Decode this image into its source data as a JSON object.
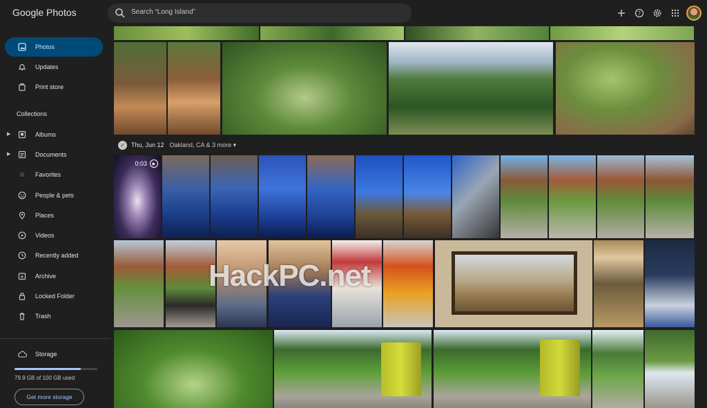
{
  "app": {
    "title": "Google Photos"
  },
  "search": {
    "placeholder": "Search “Long Island”",
    "value": ""
  },
  "top_icons": [
    "add-icon",
    "help-icon",
    "settings-icon",
    "apps-grid-icon",
    "account-avatar"
  ],
  "sidebar": {
    "items": [
      {
        "label": "Photos",
        "icon": "photos-icon",
        "active": true
      },
      {
        "label": "Updates",
        "icon": "bell-icon"
      },
      {
        "label": "Print store",
        "icon": "print-store-icon"
      }
    ],
    "collections_title": "Collections",
    "collections": [
      {
        "label": "Albums",
        "icon": "album-icon",
        "expandable": true
      },
      {
        "label": "Documents",
        "icon": "document-icon",
        "expandable": true
      },
      {
        "label": "Favorites",
        "icon": "star-icon"
      },
      {
        "label": "People & pets",
        "icon": "face-icon"
      },
      {
        "label": "Places",
        "icon": "place-pin-icon"
      },
      {
        "label": "Videos",
        "icon": "video-play-icon"
      },
      {
        "label": "Recently added",
        "icon": "clock-icon"
      },
      {
        "label": "Archive",
        "icon": "archive-icon"
      },
      {
        "label": "Locked Folder",
        "icon": "lock-icon"
      },
      {
        "label": "Trash",
        "icon": "trash-icon"
      }
    ],
    "storage": {
      "label": "Storage",
      "usage_text": "79.9 GB of 100 GB used",
      "used_fraction": 0.799,
      "button_label": "Get more storage"
    }
  },
  "grid": {
    "date_header": {
      "date": "Thu, Jun 12",
      "location": "Oakland, CA & 3 more"
    },
    "video_duration": "0:03"
  },
  "watermark": "HackPC.net",
  "colors": {
    "background": "#1f1f1f",
    "active_nav": "#004a77",
    "accent": "#a8c7fa"
  }
}
